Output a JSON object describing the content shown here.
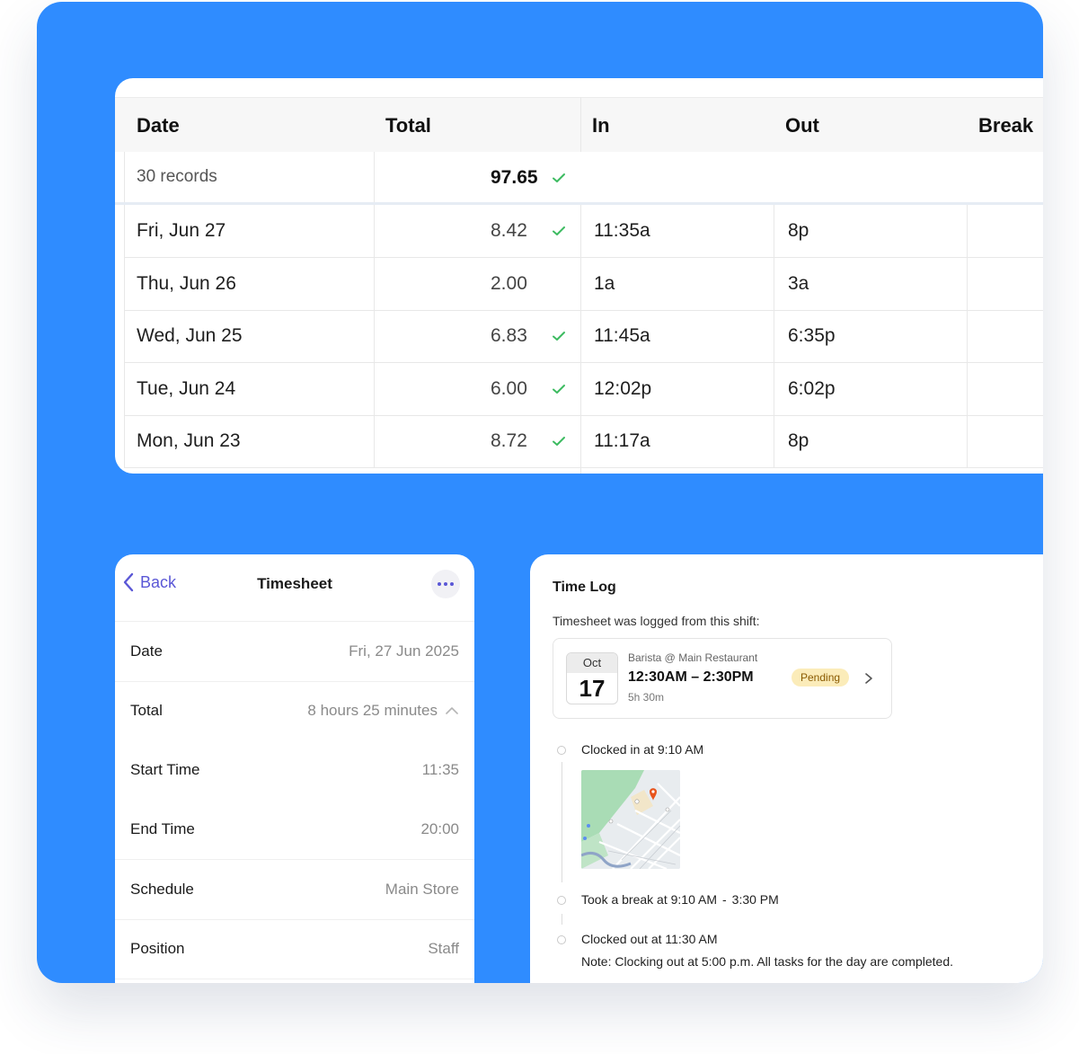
{
  "table": {
    "headers": {
      "date": "Date",
      "total": "Total",
      "in": "In",
      "out": "Out",
      "break": "Break"
    },
    "summary": {
      "records": "30 records",
      "total": "97.65"
    },
    "rows": [
      {
        "date": "Fri, Jun 27",
        "total": "8.42",
        "approved": true,
        "in": "11:35a",
        "out": "8p"
      },
      {
        "date": "Thu, Jun 26",
        "total": "2.00",
        "approved": false,
        "in": "1a",
        "out": "3a"
      },
      {
        "date": "Wed, Jun 25",
        "total": "6.83",
        "approved": true,
        "in": "11:45a",
        "out": "6:35p"
      },
      {
        "date": "Tue, Jun 24",
        "total": "6.00",
        "approved": true,
        "in": "12:02p",
        "out": "6:02p"
      },
      {
        "date": "Mon, Jun 23",
        "total": "8.72",
        "approved": true,
        "in": "11:17a",
        "out": "8p"
      }
    ]
  },
  "timesheet": {
    "back_label": "Back",
    "title": "Timesheet",
    "fields": [
      {
        "label": "Date",
        "value": "Fri, 27 Jun 2025"
      },
      {
        "label": "Total",
        "value": "8 hours 25 minutes"
      },
      {
        "label": "Start Time",
        "value": "11:35"
      },
      {
        "label": "End Time",
        "value": "20:00"
      },
      {
        "label": "Schedule",
        "value": "Main Store"
      },
      {
        "label": "Position",
        "value": "Staff"
      }
    ]
  },
  "time_log": {
    "title": "Time Log",
    "subtitle": "Timesheet was logged from this shift:",
    "shift": {
      "month": "Oct",
      "day": "17",
      "role": "Barista @ Main Restaurant",
      "time": "12:30AM – 2:30PM",
      "duration": "5h 30m",
      "status": "Pending"
    },
    "events": {
      "clock_in": {
        "prefix": "Clocked in at",
        "time": "9:10 AM"
      },
      "break": {
        "prefix": "Took a break at",
        "start": "9:10 AM",
        "sep": "-",
        "end": "3:30 PM"
      },
      "clock_out": {
        "prefix": "Clocked out at",
        "time": "11:30 AM"
      },
      "note": "Note: Clocking out at 5:00 p.m. All tasks for the day are completed."
    }
  },
  "colors": {
    "background": "#2f8cff",
    "accent": "#5a57d6",
    "check": "#3dbb61",
    "pending_bg": "#fbecb9",
    "pin": "#e8541c"
  }
}
